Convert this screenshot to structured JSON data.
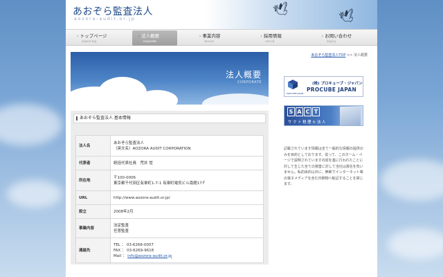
{
  "header": {
    "logo": "あおぞら監査法人",
    "logo_sub": "aozora-audit.or.jp"
  },
  "nav": [
    {
      "label": "トップページ",
      "sub": "aozora top",
      "active": false
    },
    {
      "label": "法人概要",
      "sub": "corporate",
      "active": true
    },
    {
      "label": "事業内容",
      "sub": "service",
      "active": false
    },
    {
      "label": "採用情報",
      "sub": "recruit",
      "active": false
    },
    {
      "label": "お問い合わせ",
      "sub": "inquiry",
      "active": false
    }
  ],
  "breadcrumb": {
    "home": "あおぞら監査法人TOP",
    "separator": ">>",
    "current": "法人概要"
  },
  "hero": {
    "title": "法人概要",
    "subtitle": "CORPORATE"
  },
  "section": {
    "heading": "あおぞら監査法人 基本情報",
    "rows": {
      "name": {
        "label": "法人名",
        "line1": "あおぞら監査法人",
        "line2": "（英文名）AOZORA AUDIT CORPORATION"
      },
      "rep": {
        "label": "代表者",
        "line1": "統括代表社員　荒井 覚"
      },
      "addr": {
        "label": "所在地",
        "line1": "〒100-0006",
        "line2": "東京都千代田区有楽町1-7-1 有楽町電気ビル南館17Ｆ"
      },
      "url": {
        "label": "URL",
        "line1": "http://www.aozora-audit.or.jp/"
      },
      "est": {
        "label": "設立",
        "line1": "2008年2月"
      },
      "biz": {
        "label": "事業内容",
        "line1": "法定監査",
        "line2": "任意監査"
      },
      "contact": {
        "label": "連絡先",
        "tel": "TEL ： 03-6268-0007",
        "fax": "FAX ： 03-6269-9618",
        "mail_prefix": "Mail ：",
        "mail": "info@aozora-audit.or.jp"
      }
    }
  },
  "sidebar": {
    "procube": {
      "line1": "(株) プロキューブ・ジャパン",
      "line2": "PROCUBE JAPAN",
      "small": "PROCUBE JAPAN"
    },
    "sact": {
      "letters": [
        "S",
        "A",
        "C",
        "T"
      ],
      "sub": "サクト税理士法人"
    },
    "disclaimer": "記載されています情報は全て一般的な情報の提供のみを目的としております。従って、このホーム・ページで説明されています内容を基に行われたことに対して生じた全ての損害に対して当社は責任を負いません。私的目的以外に、無断でインターネット等の電子メディアを含む印刷物へ転記することを禁じます。"
  },
  "colors": {
    "logo": "#1f4a8a",
    "link": "#2255aa",
    "hero_top": "#2b5ea8",
    "nav_active": "#a8a8a8"
  }
}
